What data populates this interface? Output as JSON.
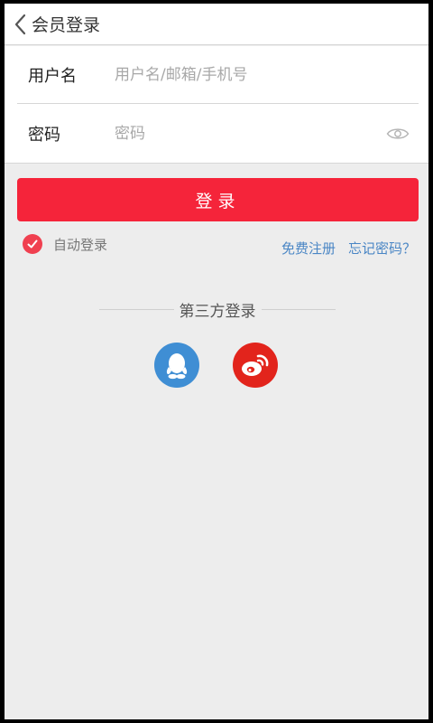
{
  "header": {
    "title": "会员登录",
    "back_icon": "chevron-left-icon"
  },
  "form": {
    "username": {
      "label": "用户名",
      "placeholder": "用户名/邮箱/手机号",
      "value": ""
    },
    "password": {
      "label": "密码",
      "placeholder": "密码",
      "value": "",
      "toggle_icon": "eye-icon"
    }
  },
  "login_button": {
    "label": "登录"
  },
  "auto_login": {
    "label": "自动登录",
    "checked": true
  },
  "links": {
    "register": "免费注册",
    "forgot": "忘记密码？"
  },
  "third_party": {
    "label": "第三方登录",
    "providers": [
      {
        "name": "qq",
        "icon": "qq-icon",
        "color": "#3f8ed4"
      },
      {
        "name": "weibo",
        "icon": "weibo-icon",
        "color": "#e2241c"
      }
    ]
  },
  "colors": {
    "accent": "#f5243a",
    "link": "#4a86c5",
    "background": "#ededed"
  }
}
